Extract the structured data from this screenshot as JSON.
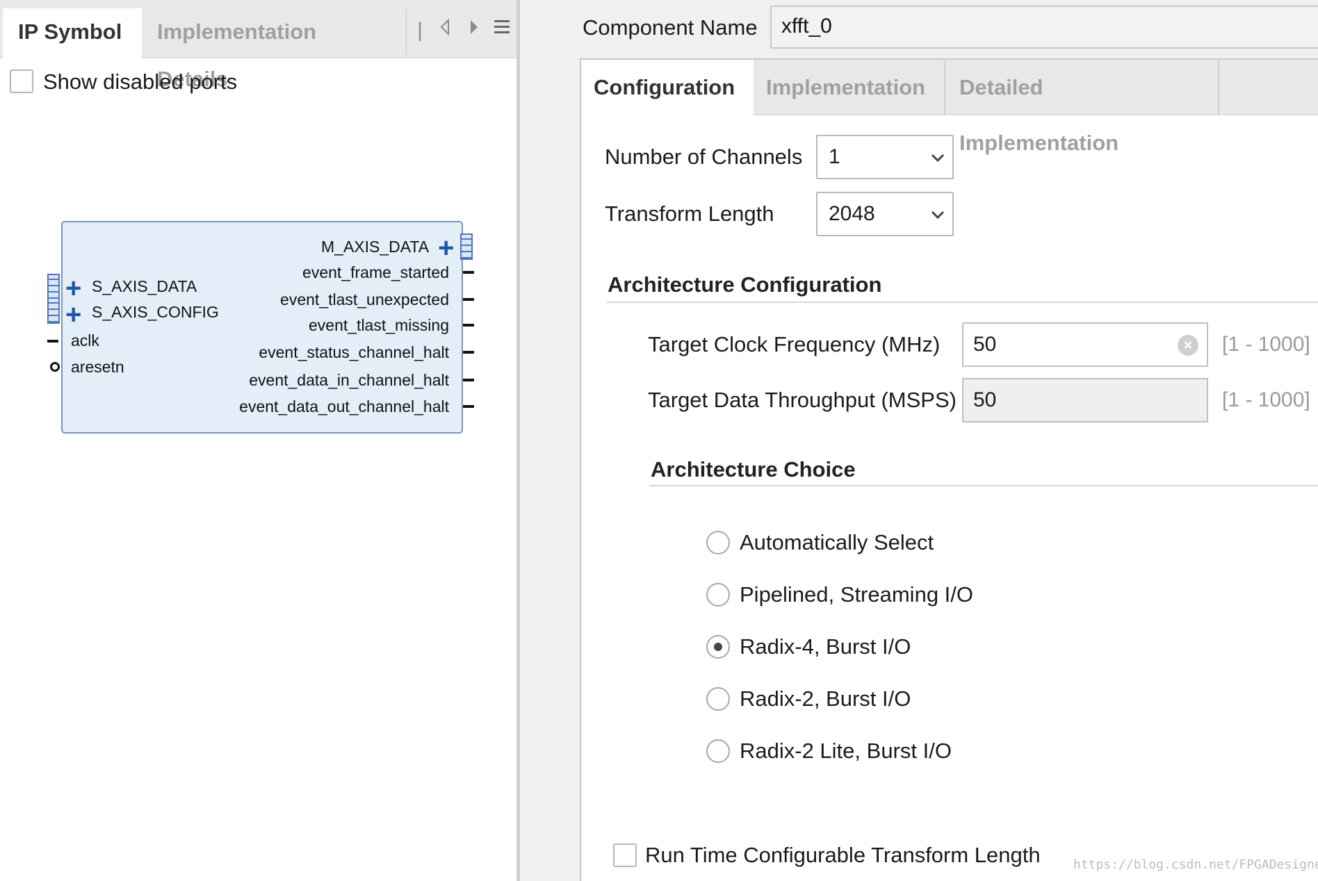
{
  "left": {
    "tabs": [
      {
        "label": "IP Symbol",
        "active": true
      },
      {
        "label": "Implementation Details",
        "active": false
      }
    ],
    "nav_icons": [
      "tab-overflow-icon",
      "chevron-left-icon",
      "chevron-right-icon",
      "menu-icon"
    ],
    "show_disabled_ports": {
      "label": "Show disabled ports",
      "checked": false
    },
    "symbol": {
      "left_ports": [
        {
          "name": "S_AXIS_DATA",
          "kind": "bus"
        },
        {
          "name": "S_AXIS_CONFIG",
          "kind": "bus"
        },
        {
          "name": "aclk",
          "kind": "wire"
        },
        {
          "name": "aresetn",
          "kind": "active-low"
        }
      ],
      "right_ports": [
        {
          "name": "M_AXIS_DATA",
          "kind": "bus"
        },
        {
          "name": "event_frame_started",
          "kind": "wire"
        },
        {
          "name": "event_tlast_unexpected",
          "kind": "wire"
        },
        {
          "name": "event_tlast_missing",
          "kind": "wire"
        },
        {
          "name": "event_status_channel_halt",
          "kind": "wire"
        },
        {
          "name": "event_data_in_channel_halt",
          "kind": "wire"
        },
        {
          "name": "event_data_out_channel_halt",
          "kind": "wire"
        }
      ]
    }
  },
  "right": {
    "component_name_label": "Component Name",
    "component_name_value": "xfft_0",
    "tabs": [
      {
        "label": "Configuration",
        "active": true
      },
      {
        "label": "Implementation",
        "active": false
      },
      {
        "label": "Detailed Implementation",
        "active": false
      }
    ],
    "num_channels": {
      "label": "Number of Channels",
      "value": "1"
    },
    "transform_length": {
      "label": "Transform Length",
      "value": "2048"
    },
    "arch_config": {
      "title": "Architecture Configuration",
      "clock": {
        "label": "Target Clock Frequency (MHz)",
        "value": "50",
        "range": "[1 - 1000]"
      },
      "throughput": {
        "label": "Target Data Throughput (MSPS)",
        "value": "50",
        "range": "[1 - 1000]"
      }
    },
    "arch_choice": {
      "title": "Architecture Choice",
      "options": [
        {
          "label": "Automatically Select",
          "checked": false
        },
        {
          "label": "Pipelined, Streaming I/O",
          "checked": false
        },
        {
          "label": "Radix-4, Burst I/O",
          "checked": true
        },
        {
          "label": "Radix-2, Burst I/O",
          "checked": false
        },
        {
          "label": "Radix-2 Lite, Burst I/O",
          "checked": false
        }
      ]
    },
    "runtime_config": {
      "label": "Run Time Configurable Transform Length",
      "checked": false
    }
  },
  "watermark": "https://blog.csdn.net/FPGADesigner",
  "colors": {
    "block_fill": "#e3eef9",
    "block_border": "#7c93b4",
    "bus_blue": "#1f58a8"
  }
}
